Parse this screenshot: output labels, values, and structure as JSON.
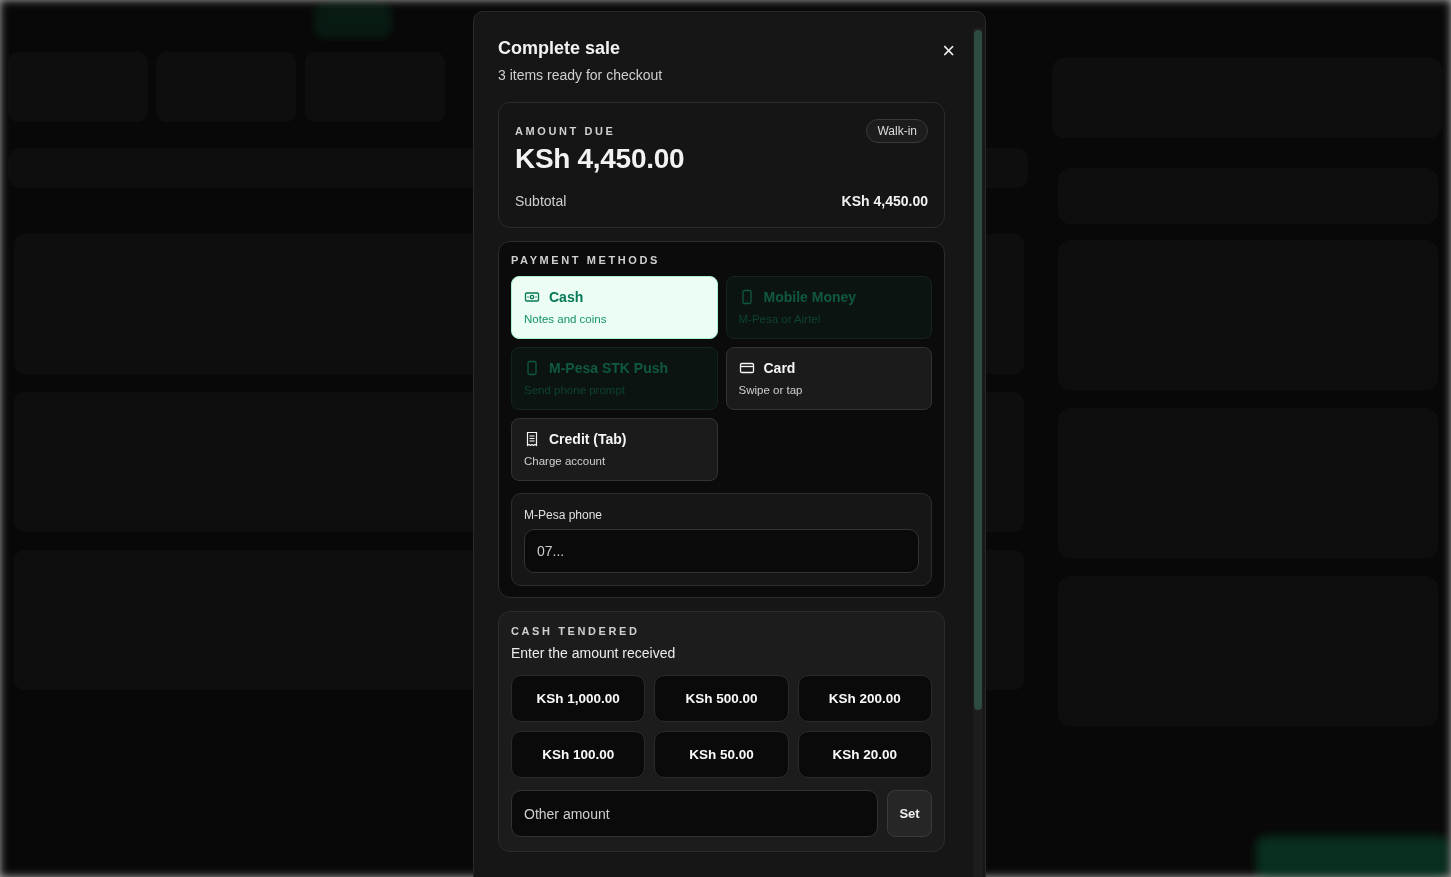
{
  "dialog": {
    "title": "Complete sale",
    "subtitle": "3 items ready for checkout",
    "close": "×"
  },
  "amount_due": {
    "label": "AMOUNT DUE",
    "customer": "Walk-in",
    "total": "KSh 4,450.00",
    "subtotal_label": "Subtotal",
    "subtotal": "KSh 4,450.00"
  },
  "payment_methods": {
    "heading": "PAYMENT METHODS",
    "items": [
      {
        "kind": "cash",
        "name": "Cash",
        "hint": "Notes and coins",
        "selected": true,
        "disabled": false
      },
      {
        "kind": "phone",
        "name": "Mobile Money",
        "hint": "M-Pesa or Airtel",
        "selected": false,
        "disabled": true
      },
      {
        "kind": "phone",
        "name": "M-Pesa STK Push",
        "hint": "Send phone prompt",
        "selected": false,
        "disabled": true
      },
      {
        "kind": "card",
        "name": "Card",
        "hint": "Swipe or tap",
        "selected": false,
        "disabled": false
      },
      {
        "kind": "receipt",
        "name": "Credit (Tab)",
        "hint": "Charge account",
        "selected": false,
        "disabled": false
      }
    ],
    "phone_label": "M-Pesa phone",
    "phone_placeholder": "07..."
  },
  "cash_tendered": {
    "heading": "CASH TENDERED",
    "prompt": "Enter the amount received",
    "amounts": [
      "KSh 1,000.00",
      "KSh 500.00",
      "KSh 200.00",
      "KSh 100.00",
      "KSh 50.00",
      "KSh 20.00"
    ],
    "other_placeholder": "Other amount",
    "set_button": "Set"
  }
}
